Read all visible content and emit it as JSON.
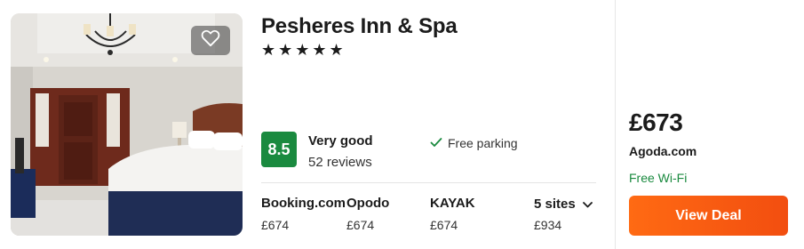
{
  "hotel": {
    "name": "Pesheres Inn & Spa",
    "stars": "★★★★★",
    "score": "8.5",
    "rating_word": "Very good",
    "review_count": "52 reviews",
    "amenity": "Free parking"
  },
  "sites": [
    {
      "name": "Booking.com",
      "price": "£674"
    },
    {
      "name": "Opodo",
      "price": "£674"
    },
    {
      "name": "KAYAK",
      "price": "£674"
    },
    {
      "name": "5 sites",
      "price": "£934"
    }
  ],
  "deal": {
    "price": "£673",
    "provider": "Agoda.com",
    "extra": "Free Wi-Fi",
    "button_label": "View Deal"
  },
  "colors": {
    "score_badge": "#1a8a3f",
    "cta": "#f24e10",
    "wifi_text": "#1a8a3f"
  },
  "icons": {
    "favorite": "heart-icon",
    "amenity": "check-icon",
    "expand": "chevron-down-icon"
  }
}
